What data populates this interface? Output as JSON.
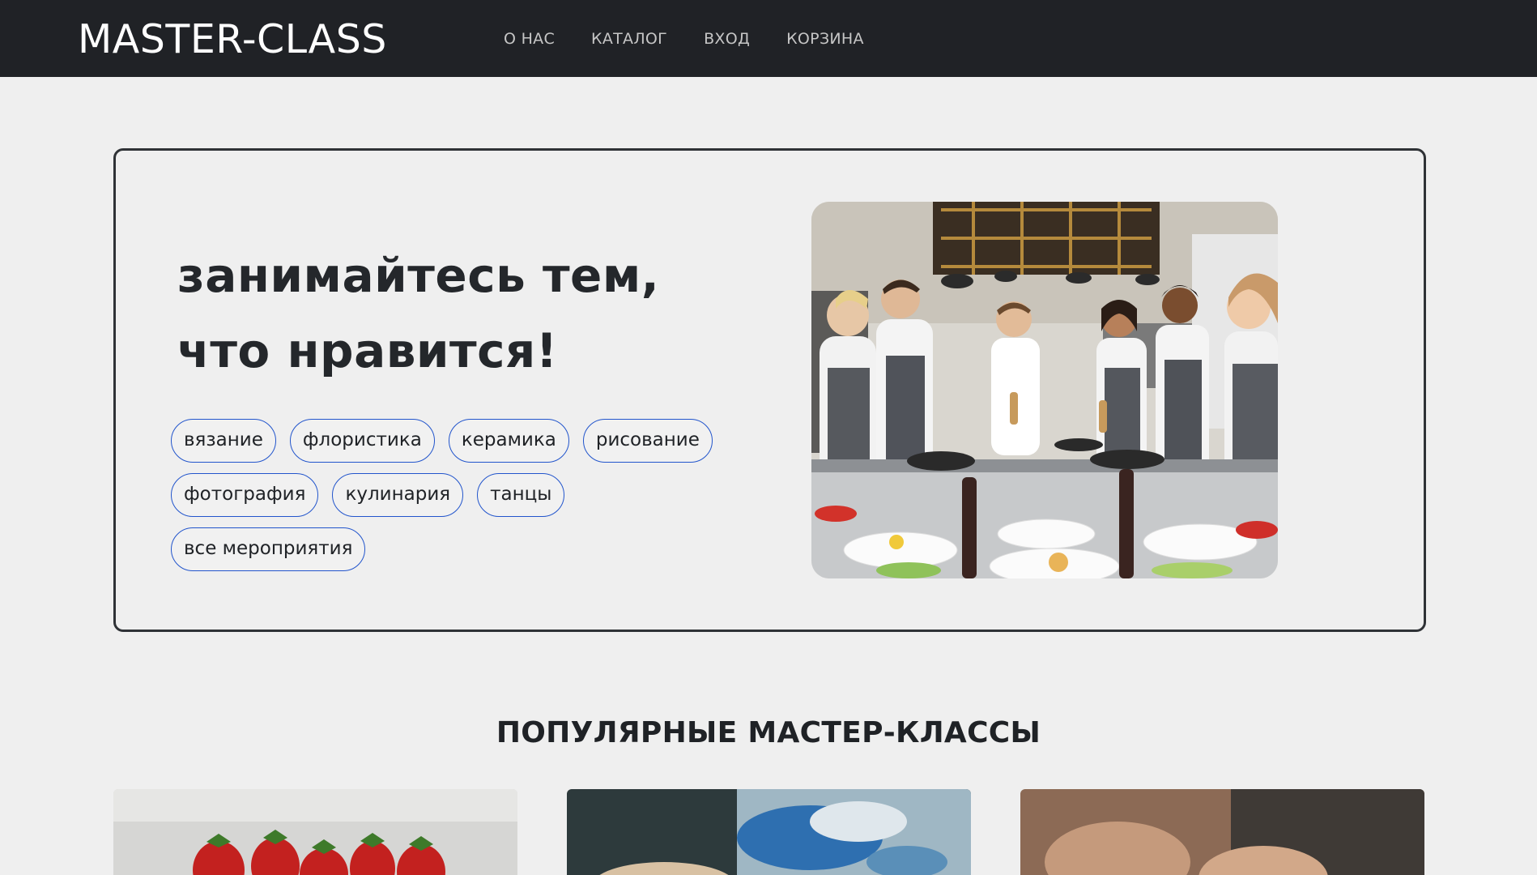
{
  "header": {
    "logo": "MASTER-CLASS",
    "nav": [
      "О НАС",
      "КАТАЛОГ",
      "ВХОД",
      "КОРЗИНА"
    ]
  },
  "hero": {
    "title_line1": "занимайтесь тем,",
    "title_line2": "что нравится!",
    "tags": [
      "вязание",
      "флористика",
      "керамика",
      "рисование",
      "фотография",
      "кулинария",
      "танцы",
      "все мероприятия"
    ]
  },
  "popular": {
    "title": "ПОПУЛЯРНЫЕ МАСТЕР-КЛАССЫ"
  },
  "colors": {
    "header_bg": "#202226",
    "page_bg": "#efefef",
    "tag_border": "#2255cc"
  }
}
